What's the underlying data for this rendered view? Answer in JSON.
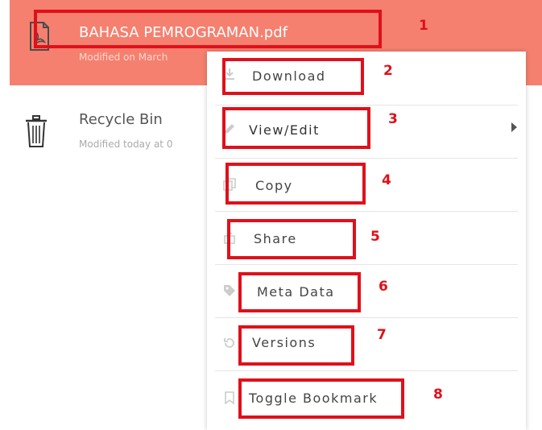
{
  "files": [
    {
      "name": "BAHASA PEMROGRAMAN.pdf",
      "meta": "Modified on March",
      "icon": "pdf-file-icon",
      "selected": true
    },
    {
      "name": "Recycle Bin",
      "meta": "Modified today at 0",
      "icon": "trash-icon",
      "selected": false
    }
  ],
  "menu": {
    "items": [
      {
        "label": "Download",
        "icon": "download-icon"
      },
      {
        "label": "View/Edit",
        "icon": "edit-icon",
        "submenu": true
      },
      {
        "label": "Copy",
        "icon": "copy-icon"
      },
      {
        "label": "Share",
        "icon": "share-icon"
      },
      {
        "label": "Meta Data",
        "icon": "tag-icon"
      },
      {
        "label": "Versions",
        "icon": "history-icon"
      },
      {
        "label": "Toggle Bookmark",
        "icon": "bookmark-icon"
      }
    ]
  },
  "annotations": [
    "1",
    "2",
    "3",
    "4",
    "5",
    "6",
    "7",
    "8"
  ],
  "colors": {
    "selected_row": "#f5806f",
    "annotation": "#e0101a"
  }
}
